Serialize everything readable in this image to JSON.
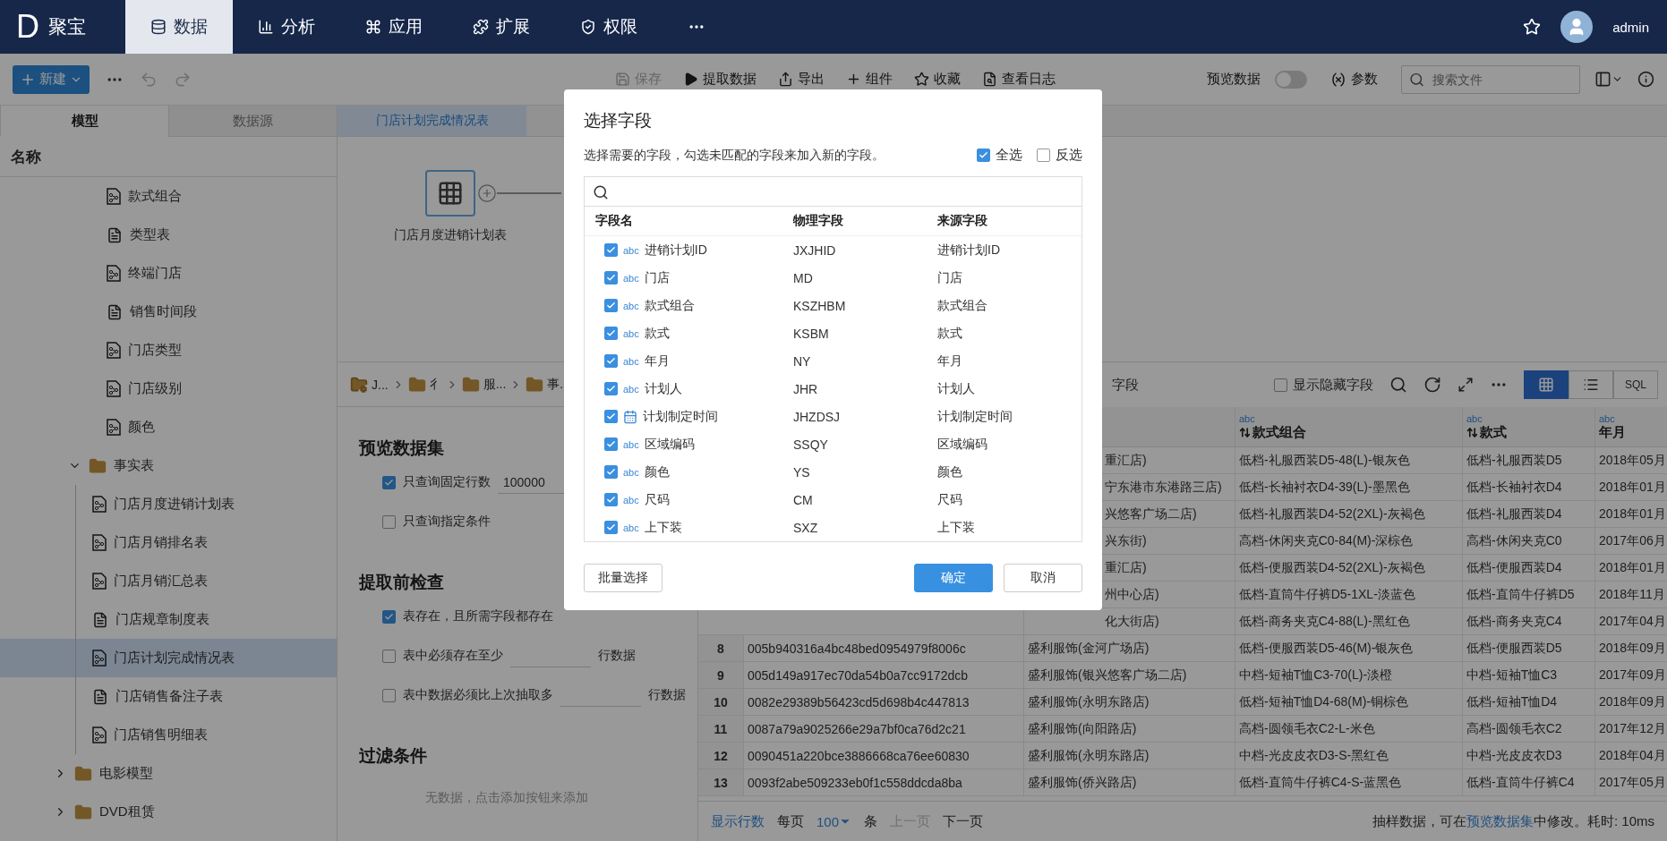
{
  "nav": {
    "logo_letter": "D",
    "brand": "聚宝",
    "tabs": [
      {
        "label": "数据",
        "kind": "data",
        "selected": true
      },
      {
        "label": "分析",
        "kind": "analysis",
        "selected": false
      },
      {
        "label": "应用",
        "kind": "apps",
        "selected": false
      },
      {
        "label": "扩展",
        "kind": "extend",
        "selected": false
      },
      {
        "label": "权限",
        "kind": "permission",
        "selected": false
      }
    ],
    "user": "admin"
  },
  "toolbar": {
    "new_label": "新建",
    "undo_disabled": true,
    "redo_disabled": true,
    "actions": [
      {
        "label": "保存",
        "kind": "save",
        "disabled": true
      },
      {
        "label": "提取数据",
        "kind": "extract",
        "disabled": false
      },
      {
        "label": "导出",
        "kind": "export",
        "disabled": false
      },
      {
        "label": "组件",
        "kind": "component",
        "disabled": false
      },
      {
        "label": "收藏",
        "kind": "favorite",
        "disabled": false
      },
      {
        "label": "查看日志",
        "kind": "log",
        "disabled": false
      }
    ],
    "preview_label": "预览数据",
    "preview_on": false,
    "params_label": "参数",
    "search_placeholder": "搜索文件"
  },
  "sidebar": {
    "tabs": [
      {
        "label": "模型",
        "selected": true
      },
      {
        "label": "数据源",
        "selected": false
      }
    ],
    "header": "名称",
    "tree": [
      {
        "children": [
          {
            "label": "款式组合",
            "kind": "model",
            "selected": false
          },
          {
            "label": "类型表",
            "kind": "table",
            "selected": false
          },
          {
            "label": "终端门店",
            "kind": "model",
            "selected": false
          },
          {
            "label": "销售时间段",
            "kind": "table",
            "selected": false
          },
          {
            "label": "门店类型",
            "kind": "model",
            "selected": false
          },
          {
            "label": "门店级别",
            "kind": "model",
            "selected": false
          },
          {
            "label": "颜色",
            "kind": "model",
            "selected": false
          },
          {
            "label": "事实表",
            "kind": "folder",
            "expanded": true,
            "selected": false,
            "children": [
              {
                "label": "门店月度进销计划表",
                "kind": "model",
                "selected": false
              },
              {
                "label": "门店月销排名表",
                "kind": "model",
                "selected": false
              },
              {
                "label": "门店月销汇总表",
                "kind": "model",
                "selected": false
              },
              {
                "label": "门店规章制度表",
                "kind": "table",
                "selected": false
              },
              {
                "label": "门店计划完成情况表",
                "kind": "model",
                "selected": true
              },
              {
                "label": "门店销售备注子表",
                "kind": "table",
                "selected": false
              },
              {
                "label": "门店销售明细表",
                "kind": "model",
                "selected": false
              }
            ]
          }
        ]
      },
      {
        "label": "电影模型",
        "kind": "folder",
        "expanded": false,
        "selected": false
      },
      {
        "label": "DVD租赁",
        "kind": "folder",
        "expanded": false,
        "selected": false
      }
    ]
  },
  "editor_tabs": [
    {
      "label": "门店计划完成情况表",
      "selected": true
    }
  ],
  "canvas": {
    "nodes": [
      {
        "label": "门店月度进销计划表"
      }
    ]
  },
  "breadcrumb": [
    "J...",
    "彳",
    "服...",
    "事."
  ],
  "config": {
    "sections": [
      {
        "title": "预览数据集",
        "options": [
          {
            "kind": "field",
            "label": "只查询固定行数",
            "checked": true,
            "value": "100000"
          },
          {
            "kind": "plain",
            "label": "只查询指定条件",
            "checked": false
          }
        ]
      },
      {
        "title": "提取前检查",
        "options": [
          {
            "kind": "plain",
            "label": "表存在，且所需字段都存在",
            "checked": true
          },
          {
            "kind": "field",
            "label": "表中必须存在至少",
            "checked": false,
            "suffix": "行数据"
          },
          {
            "kind": "field",
            "label": "表中数据必须比上次抽取多",
            "checked": false,
            "suffix": "行数据"
          }
        ]
      },
      {
        "title": "过滤条件",
        "empty_text": "无数据，点击添加按钮来添加"
      }
    ]
  },
  "table": {
    "toolbar_text": "字段",
    "show_hidden_label": "显示隐藏字段",
    "show_hidden_checked": false,
    "views": [
      {
        "kind": "grid",
        "selected": true
      },
      {
        "kind": "list",
        "selected": false
      },
      {
        "kind": "sql",
        "label": "SQL",
        "selected": false
      }
    ],
    "columns": [
      {
        "type_label": "abc",
        "label": "款式组合",
        "sortable": true
      },
      {
        "type_label": "abc",
        "label": "款式",
        "sortable": true
      },
      {
        "type_label": "abc",
        "label": "年月",
        "sortable": false
      }
    ],
    "rows": [
      {
        "store": "重汇店)",
        "combo": "低档-礼服西装D5-48(L)-银灰色",
        "style": "低档-礼服西装D5",
        "month": "2018年05月"
      },
      {
        "store": "宁东港市东港路三店)",
        "combo": "低档-长袖衬衣D4-39(L)-墨黑色",
        "style": "低档-长袖衬衣D4",
        "month": "2018年01月"
      },
      {
        "store": "兴悠客广场二店)",
        "combo": "低档-礼服西装D4-52(2XL)-灰褐色",
        "style": "低档-礼服西装D4",
        "month": "2018年01月"
      },
      {
        "store": "兴东街)",
        "combo": "高档-休闲夹克C0-84(M)-深棕色",
        "style": "高档-休闲夹克C0",
        "month": "2017年06月"
      },
      {
        "store": "重汇店)",
        "combo": "低档-便服西装D4-52(2XL)-灰褐色",
        "style": "低档-便服西装D4",
        "month": "2018年01月"
      },
      {
        "store": "州中心店)",
        "combo": "低档-直筒牛仔裤D5-1XL-淡蓝色",
        "style": "低档-直筒牛仔裤D5",
        "month": "2018年11月"
      },
      {
        "store": "化大街店)",
        "combo": "低档-商务夹克C4-88(L)-黑红色",
        "style": "低档-商务夹克C4",
        "month": "2017年04月"
      },
      {
        "number": "8",
        "id": "005b940316a4bc48bed0954979f8006c",
        "store": "盛利服饰(金河广场店)",
        "combo": "低档-便服西装D5-46(M)-银灰色",
        "style": "低档-便服西装D5",
        "month": "2018年09月"
      },
      {
        "number": "9",
        "id": "005d149a917ec70da54b0a7cc9172dcb",
        "store": "盛利服饰(银兴悠客广场二店)",
        "combo": "中档-短袖T恤C3-70(L)-淡橙",
        "style": "中档-短袖T恤C3",
        "month": "2017年09月"
      },
      {
        "number": "10",
        "id": "0082e29389b56423cd5d698b4c447813",
        "store": "盛利服饰(永明东路店)",
        "combo": "低档-短袖T恤D4-68(M)-铜棕色",
        "style": "低档-短袖T恤D4",
        "month": "2018年09月"
      },
      {
        "number": "11",
        "id": "0087a79a9025266e29a7bf0ca76d2c21",
        "store": "盛利服饰(向阳路店)",
        "combo": "高档-圆领毛衣C2-L-米色",
        "style": "高档-圆领毛衣C2",
        "month": "2017年12月"
      },
      {
        "number": "12",
        "id": "0090451a220bce3886668ca76ee60830",
        "store": "盛利服饰(永明东路店)",
        "combo": "中档-光皮皮衣D3-S-黑红色",
        "style": "中档-光皮皮衣D3",
        "month": "2018年04月"
      },
      {
        "number": "13",
        "id": "0093f2abe509233eb0f1c558ddcda8ba",
        "store": "盛利服饰(侨兴路店)",
        "combo": "低档-直筒牛仔裤C4-S-蓝黑色",
        "style": "低档-直筒牛仔裤C4",
        "month": "2017年05月"
      }
    ],
    "footer": {
      "rows_link": "显示行数",
      "per_page_label": "每页",
      "per_page": "100",
      "per_page_unit": "条",
      "prev": "上一页",
      "prev_disabled": true,
      "next": "下一页",
      "note_before": "抽样数据，可在",
      "note_link": "预览数据集",
      "note_after": "中修改。耗时: 10ms"
    }
  },
  "modal": {
    "title": "选择字段",
    "description": "选择需要的字段，勾选未匹配的字段来加入新的字段。",
    "select_all": {
      "label": "全选",
      "checked": true
    },
    "invert": {
      "label": "反选",
      "checked": false
    },
    "columns": [
      "字段名",
      "物理字段",
      "来源字段"
    ],
    "fields": [
      {
        "kind": "text",
        "type_label": "abc",
        "name": "进销计划ID",
        "physical": "JXJHID",
        "source": "进销计划ID",
        "checked": true
      },
      {
        "kind": "text",
        "type_label": "abc",
        "name": "门店",
        "physical": "MD",
        "source": "门店",
        "checked": true
      },
      {
        "kind": "text",
        "type_label": "abc",
        "name": "款式组合",
        "physical": "KSZHBM",
        "source": "款式组合",
        "checked": true
      },
      {
        "kind": "text",
        "type_label": "abc",
        "name": "款式",
        "physical": "KSBM",
        "source": "款式",
        "checked": true
      },
      {
        "kind": "text",
        "type_label": "abc",
        "name": "年月",
        "physical": "NY",
        "source": "年月",
        "checked": true
      },
      {
        "kind": "text",
        "type_label": "abc",
        "name": "计划人",
        "physical": "JHR",
        "source": "计划人",
        "checked": true
      },
      {
        "kind": "date",
        "name": "计划制定时间",
        "physical": "JHZDSJ",
        "source": "计划制定时间",
        "checked": true
      },
      {
        "kind": "text",
        "type_label": "abc",
        "name": "区域编码",
        "physical": "SSQY",
        "source": "区域编码",
        "checked": true
      },
      {
        "kind": "text",
        "type_label": "abc",
        "name": "颜色",
        "physical": "YS",
        "source": "颜色",
        "checked": true
      },
      {
        "kind": "text",
        "type_label": "abc",
        "name": "尺码",
        "physical": "CM",
        "source": "尺码",
        "checked": true
      },
      {
        "kind": "text",
        "type_label": "abc",
        "name": "上下装",
        "physical": "SXZ",
        "source": "上下装",
        "checked": true
      }
    ],
    "batch_button": "批量选择",
    "ok_button": "确定",
    "cancel_button": "取消"
  }
}
